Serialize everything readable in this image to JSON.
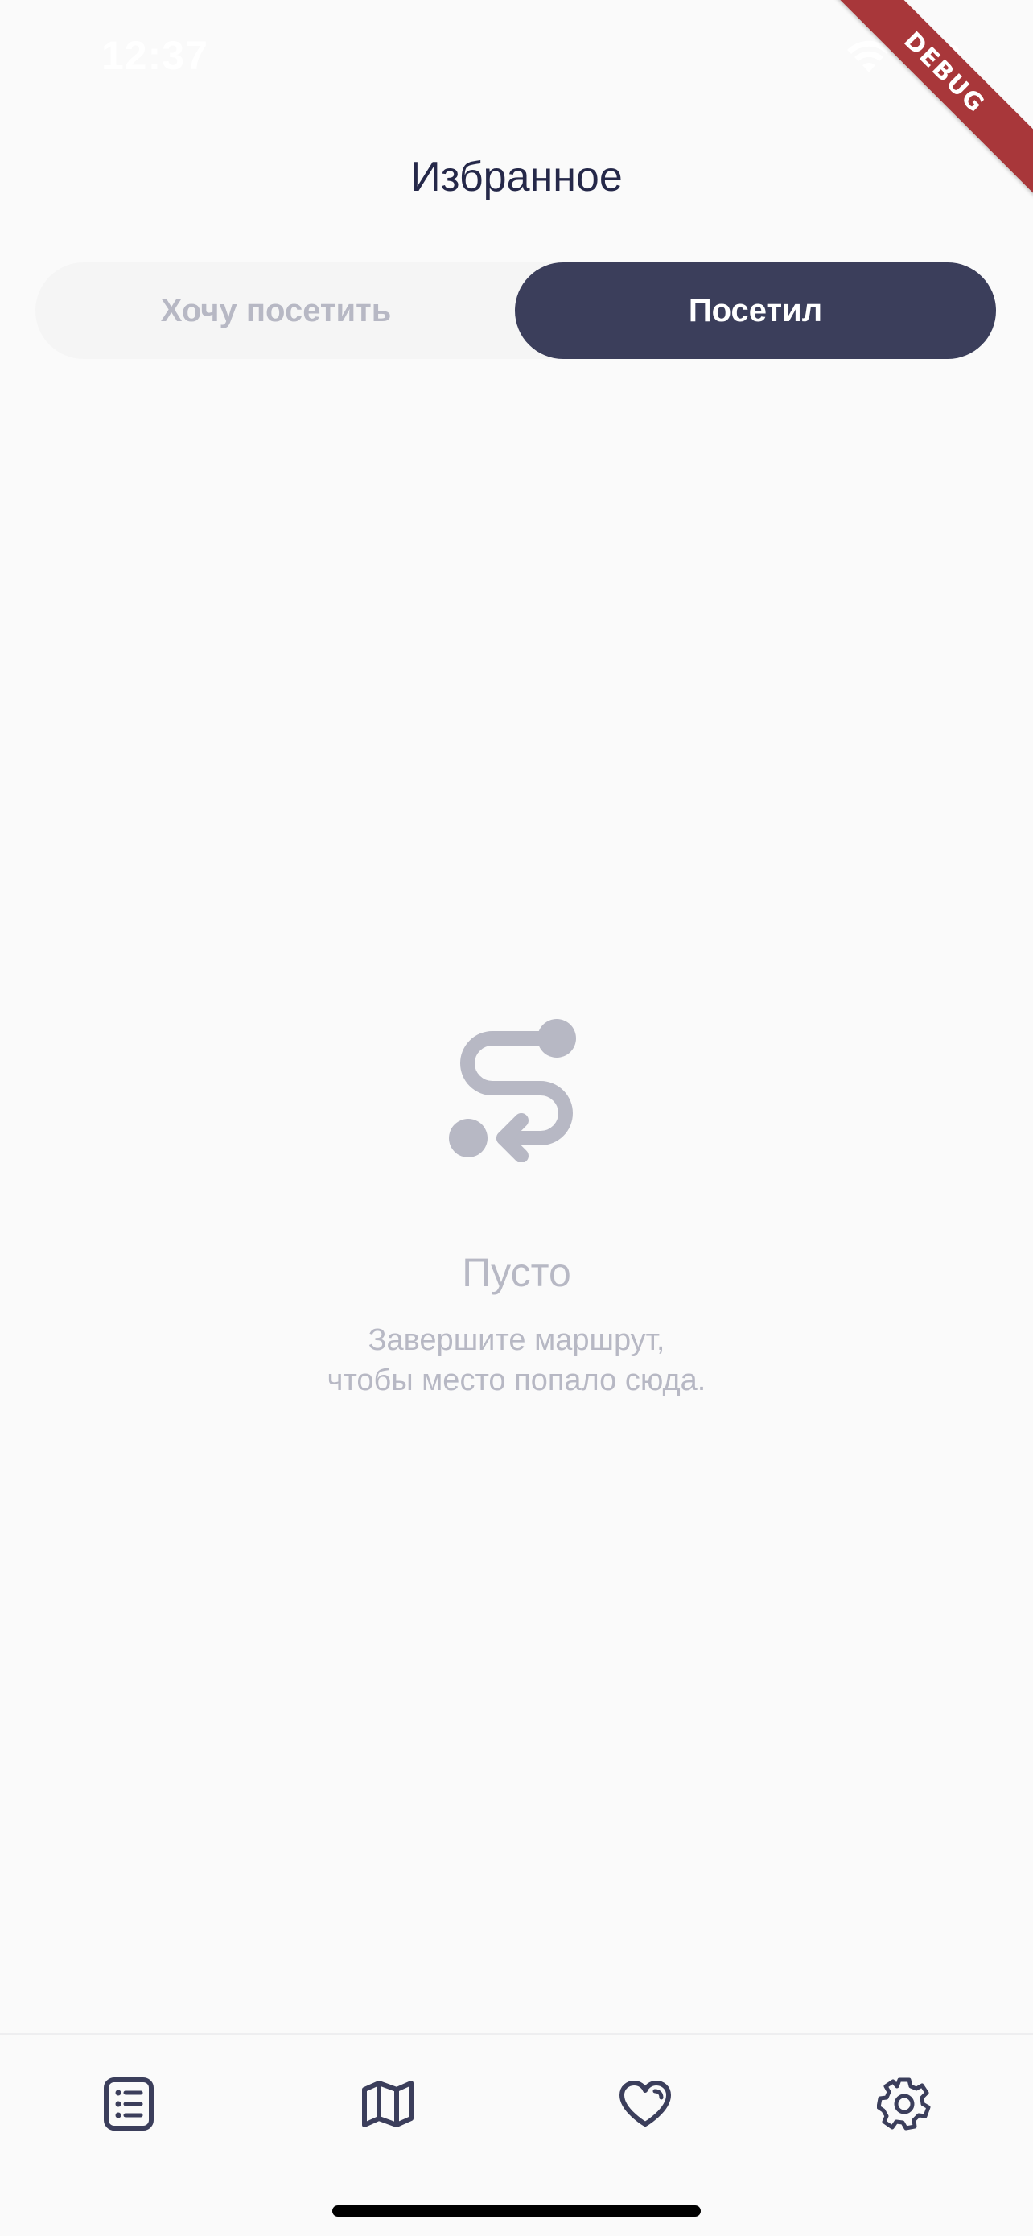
{
  "status_bar": {
    "time": "12:37"
  },
  "debug_banner": {
    "label": "DEBUG"
  },
  "header": {
    "title": "Избранное"
  },
  "segmented_control": {
    "options": [
      {
        "label": "Хочу посетить",
        "selected": false
      },
      {
        "label": "Посетил",
        "selected": true
      }
    ]
  },
  "empty_state": {
    "icon": "route-icon",
    "title": "Пусто",
    "line1": "Завершите маршрут,",
    "line2": "чтобы место попало сюда."
  },
  "bottom_nav": {
    "items": [
      {
        "icon": "list-icon",
        "active": false
      },
      {
        "icon": "map-icon",
        "active": false
      },
      {
        "icon": "heart-icon",
        "active": true
      },
      {
        "icon": "settings-icon",
        "active": false
      }
    ]
  },
  "colors": {
    "background": "#FAFAFA",
    "primary_dark": "#3B3E5B",
    "title_text": "#252849",
    "inactive_text": "#B7B8C4",
    "segment_bg": "#F5F5F5",
    "debug_banner": "#A8373A"
  }
}
